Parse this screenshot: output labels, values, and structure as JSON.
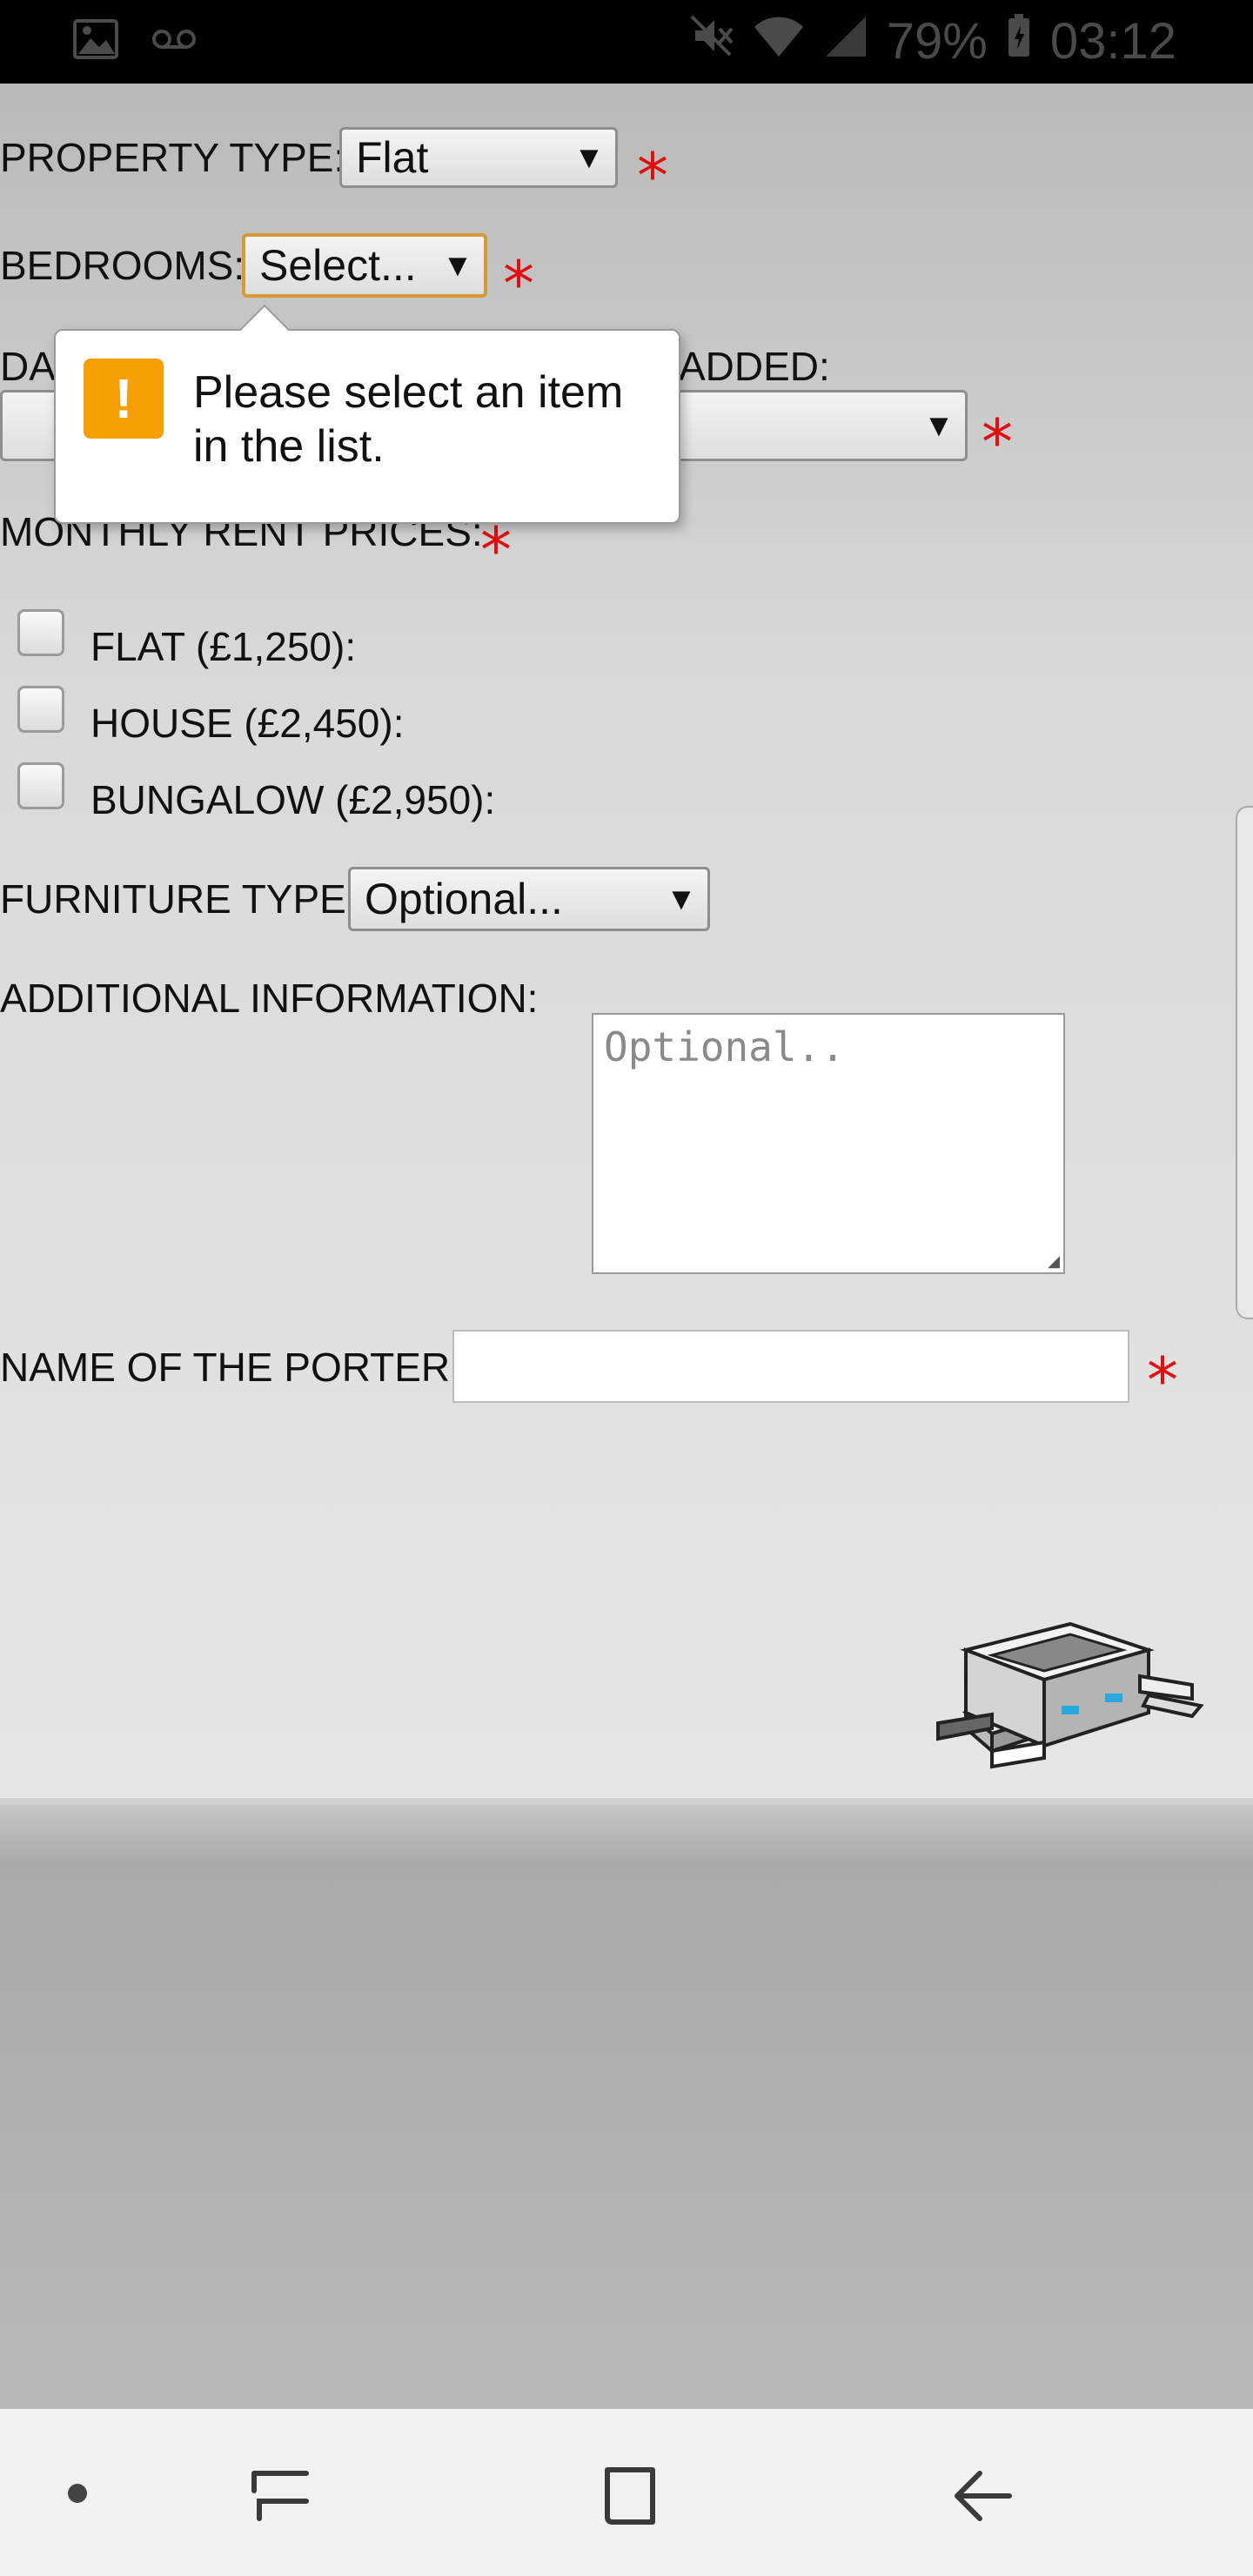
{
  "status_bar": {
    "battery": "79%",
    "time": "03:12",
    "icons": [
      "gallery-icon",
      "voicemail-icon",
      "mute-icon",
      "wifi-icon",
      "signal-icon",
      "battery-icon"
    ]
  },
  "form": {
    "property_type": {
      "label": "PROPERTY TYPE:",
      "value": "Flat"
    },
    "bedrooms": {
      "label": "BEDROOMS:",
      "value": "Select..."
    },
    "date_added": {
      "label_left": "DA",
      "label_right": "ADDED:",
      "value": ""
    },
    "rent_prices": {
      "label": "MONTHLY RENT PRICES:",
      "options": [
        {
          "label": "FLAT (£1,250):",
          "checked": false
        },
        {
          "label": "HOUSE (£2,450):",
          "checked": false
        },
        {
          "label": "BUNGALOW (£2,950):",
          "checked": false
        }
      ]
    },
    "furniture_type": {
      "label": "FURNITURE TYPE:",
      "value": "Optional..."
    },
    "additional_info": {
      "label": "ADDITIONAL INFORMATION:",
      "placeholder": "Optional.."
    },
    "porter_name": {
      "label": "NAME OF THE PORTER:",
      "value": ""
    },
    "required_marker": "*"
  },
  "tooltip": {
    "icon": "!",
    "message": "Please select an item in the list."
  },
  "colors": {
    "required": "#e01010",
    "focus_border": "#d59a36",
    "warning": "#f5a000"
  }
}
